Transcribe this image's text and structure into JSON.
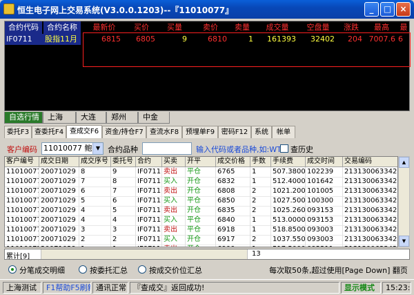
{
  "window": {
    "title": "恒生电子网上交易系统(V3.0.0.1203)--『11010077』",
    "minimize": "_",
    "maximize": "□",
    "close": "×"
  },
  "quote": {
    "headers": [
      "合约代码",
      "合约名称",
      "最新价",
      "买价",
      "买量",
      "卖价",
      "卖量",
      "成交量",
      "空盘量",
      "涨跌",
      "最高",
      "最"
    ],
    "row": [
      "IF0711",
      "股指11月",
      "6815",
      "6805",
      "9",
      "6810",
      "1",
      "161393",
      "32402",
      "204",
      "7007.6",
      "6"
    ]
  },
  "market_tabs": [
    "自选行情",
    "上海",
    "大连",
    "郑州",
    "中金"
  ],
  "func_tabs": [
    "委托F3",
    "查委托F4",
    "查成交F6",
    "资金/持仓F7",
    "查流水F8",
    "预埋单F9",
    "密码F12",
    "系统",
    "帐单"
  ],
  "query": {
    "client_label": "客户编码",
    "client_value": "11010077 鲍鎏",
    "product_label": "合约品种",
    "product_value": "",
    "hint": "输入代码或者品种,如:WT",
    "history_label": "查历史"
  },
  "grid": {
    "headers": [
      "客户编号",
      "成交日期",
      "成交序号",
      "委托号",
      "合约",
      "买卖",
      "开平",
      "成交价格",
      "手数",
      "手续费",
      "成交时间",
      "交易编码"
    ],
    "rows": [
      [
        "11010077",
        "20071029",
        "8",
        "9",
        "IF0711",
        "卖出",
        "平仓",
        "6765",
        "1",
        "507.3800",
        "102239",
        "213130063342"
      ],
      [
        "11010077",
        "20071029",
        "7",
        "8",
        "IF0711",
        "买入",
        "开仓",
        "6832",
        "1",
        "512.4000",
        "101642",
        "213130063342"
      ],
      [
        "11010077",
        "20071029",
        "6",
        "7",
        "IF0711",
        "卖出",
        "开仓",
        "6808",
        "2",
        "1021.2000",
        "101005",
        "213130063342"
      ],
      [
        "11010077",
        "20071029",
        "5",
        "6",
        "IF0711",
        "买入",
        "平仓",
        "6850",
        "2",
        "1027.5000",
        "100300",
        "213130063342"
      ],
      [
        "11010077",
        "20071029",
        "4",
        "5",
        "IF0711",
        "卖出",
        "开仓",
        "6835",
        "2",
        "1025.2600",
        "093153",
        "213130063342"
      ],
      [
        "11010077",
        "20071029",
        "4",
        "4",
        "IF0711",
        "买入",
        "平仓",
        "6840",
        "1",
        "513.0000",
        "093153",
        "213130063342"
      ],
      [
        "11010077",
        "20071029",
        "3",
        "3",
        "IF0711",
        "卖出",
        "平仓",
        "6918",
        "1",
        "518.8500",
        "093003",
        "213130063342"
      ],
      [
        "11010077",
        "20071029",
        "2",
        "2",
        "IF0711",
        "买入",
        "开仓",
        "6917",
        "2",
        "1037.5500",
        "093003",
        "213130063342"
      ],
      [
        "11010077",
        "20071029",
        "1",
        "1",
        "IF0711",
        "卖出",
        "开仓",
        "6900",
        "1",
        "517.5000",
        "092211",
        "213130063342"
      ]
    ],
    "sum_label": "累计[9]",
    "sum_lots": "13"
  },
  "radios": {
    "options": [
      "分笔成交明细",
      "按委托汇总",
      "按成交价位汇总"
    ],
    "selected": 0,
    "note": "每次取50条,超过使用[Page Down] 翻页"
  },
  "status": {
    "segments": [
      "上海测试",
      "F1帮助F5刷新",
      "通讯正常",
      "『查成交』返回成功!"
    ],
    "mode": "显示模式",
    "time": "15:23:18"
  },
  "colors": {
    "title_bar": "#0a4fc8",
    "quote_bg": "#000000",
    "quote_red": "#ff3030",
    "buy": "#1a9a1a",
    "sell": "#c01010",
    "active_market_tab": "#2a7a2a"
  }
}
